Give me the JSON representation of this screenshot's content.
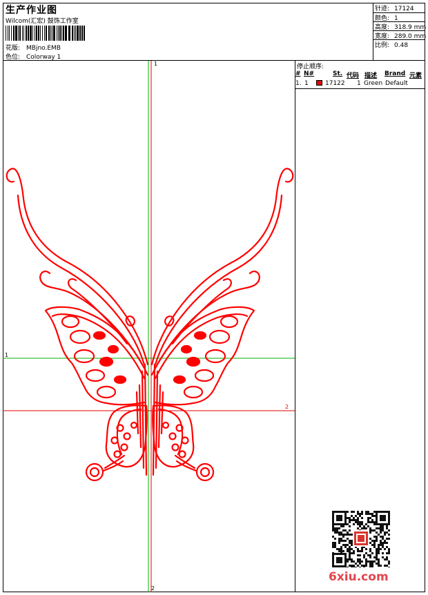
{
  "header": {
    "title": "生产作业图",
    "subtitle": "Wilcom(汇宏) 鼓饰工作室",
    "design_label": "花版:",
    "design_value": "MBjno.EMB",
    "colorway_label": "色位:",
    "colorway_value": "Colorway 1"
  },
  "specs": [
    {
      "label": "针迹:",
      "value": "17124"
    },
    {
      "label": "颜色:",
      "value": "1"
    },
    {
      "label": "高度:",
      "value": "318.9 mm"
    },
    {
      "label": "宽度:",
      "value": "289.0 mm"
    },
    {
      "label": "比例:",
      "value": "0.48"
    }
  ],
  "sequence": {
    "title": "停止顺序:",
    "columns": [
      "#",
      "N#",
      "St.",
      "代码",
      "描述",
      "Brand",
      "元素"
    ],
    "rows": [
      {
        "num": "1.",
        "needle": "1",
        "color": "#e00000",
        "stitches": "17122",
        "code": "1",
        "description": "Green",
        "brand": "Default"
      }
    ]
  },
  "axes": {
    "green_v_top": "1",
    "green_h_left": "1",
    "red_h_right": "2",
    "red_v_bottom": "2"
  },
  "watermark": "6xiu.com",
  "colors": {
    "design": "#ff0000",
    "guide_green": "#00b000",
    "guide_red": "#e00000"
  }
}
